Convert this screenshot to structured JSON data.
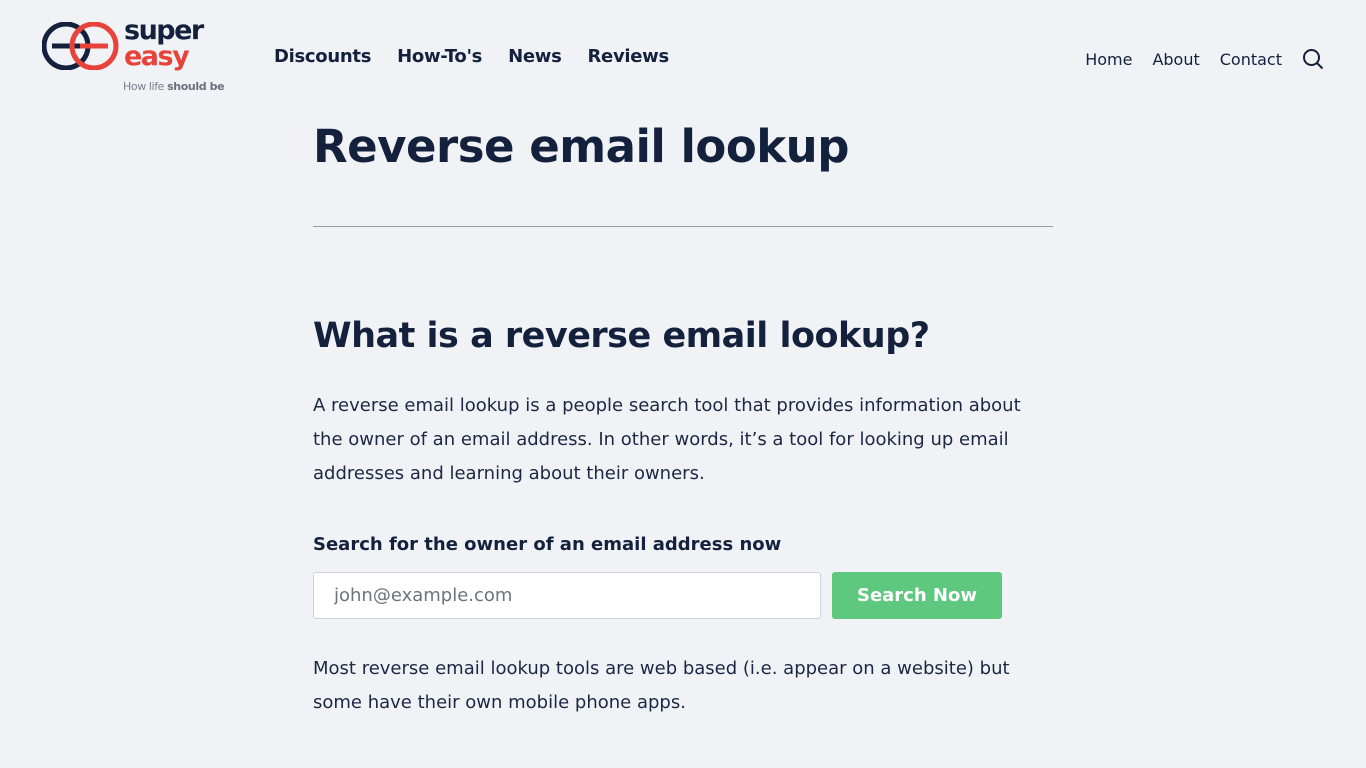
{
  "brand": {
    "word1": "super",
    "word2": "easy",
    "tagline_light": "How life ",
    "tagline_bold": "should be",
    "colors": {
      "navy": "#14213d",
      "red": "#e8423a"
    }
  },
  "main_nav": [
    {
      "label": "Discounts"
    },
    {
      "label": "How-To's"
    },
    {
      "label": "News"
    },
    {
      "label": "Reviews"
    }
  ],
  "secondary_nav": [
    {
      "label": "Home"
    },
    {
      "label": "About"
    },
    {
      "label": "Contact"
    }
  ],
  "search_icon": "search-icon",
  "article": {
    "title": "Reverse email lookup",
    "heading": "What is a reverse email lookup?",
    "intro": "A reverse email lookup is a people search tool that provides information about the owner of an email address. In other words, it’s a tool for looking up email addresses and learning about their owners.",
    "search_label": "Search for the owner of an email address now",
    "search_placeholder": "john@example.com",
    "search_button": "Search Now",
    "button_color": "#5ec87f",
    "followup": "Most reverse email lookup tools are web based (i.e. appear on a website) but some have their own mobile phone apps."
  }
}
